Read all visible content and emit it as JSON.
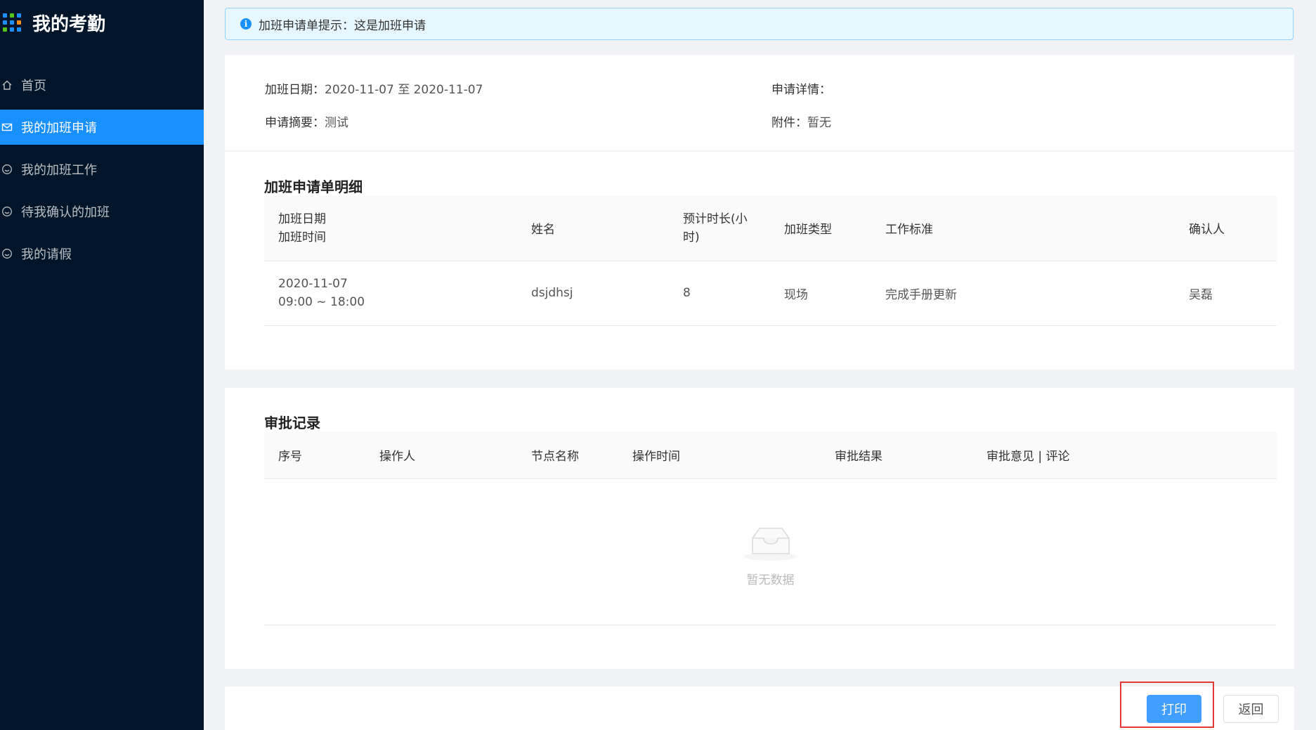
{
  "app": {
    "title": "我的考勤"
  },
  "sidebar": {
    "items": [
      {
        "label": "首页",
        "icon": "home-icon",
        "active": false
      },
      {
        "label": "我的加班申请",
        "icon": "mail-icon",
        "active": true
      },
      {
        "label": "我的加班工作",
        "icon": "smile-icon",
        "active": false
      },
      {
        "label": "待我确认的加班",
        "icon": "smile-icon",
        "active": false
      },
      {
        "label": "我的请假",
        "icon": "smile-icon",
        "active": false
      }
    ]
  },
  "alert": {
    "text": "加班申请单提示：这是加班申请"
  },
  "summary": {
    "date_label": "加班日期：",
    "date_value": "2020-11-07 至 2020-11-07",
    "detail_label": "申请详情：",
    "detail_value": "",
    "abstract_label": "申请摘要：",
    "abstract_value": "测试",
    "attachment_label": "附件：",
    "attachment_value": "暂无"
  },
  "detail": {
    "title": "加班申请单明细",
    "headers": {
      "date_line1": "加班日期",
      "date_line2": "加班时间",
      "name": "姓名",
      "duration": "预计时长(小时)",
      "type": "加班类型",
      "standard": "工作标准",
      "confirmer": "确认人"
    },
    "rows": [
      {
        "date": "2020-11-07",
        "time": "09:00 ~ 18:00",
        "name": "dsjdhsj",
        "duration": "8",
        "type": "现场",
        "standard": "完成手册更新",
        "confirmer": "吴磊"
      }
    ]
  },
  "approval": {
    "title": "审批记录",
    "headers": [
      "序号",
      "操作人",
      "节点名称",
      "操作时间",
      "审批结果",
      "审批意见 | 评论"
    ],
    "empty_text": "暂无数据"
  },
  "actions": {
    "print_label": "打印",
    "back_label": "返回"
  },
  "colors": {
    "sidebar_bg": "#001529",
    "accent": "#1890ff",
    "button_primary": "#409eff",
    "highlight_border": "#e53935"
  }
}
